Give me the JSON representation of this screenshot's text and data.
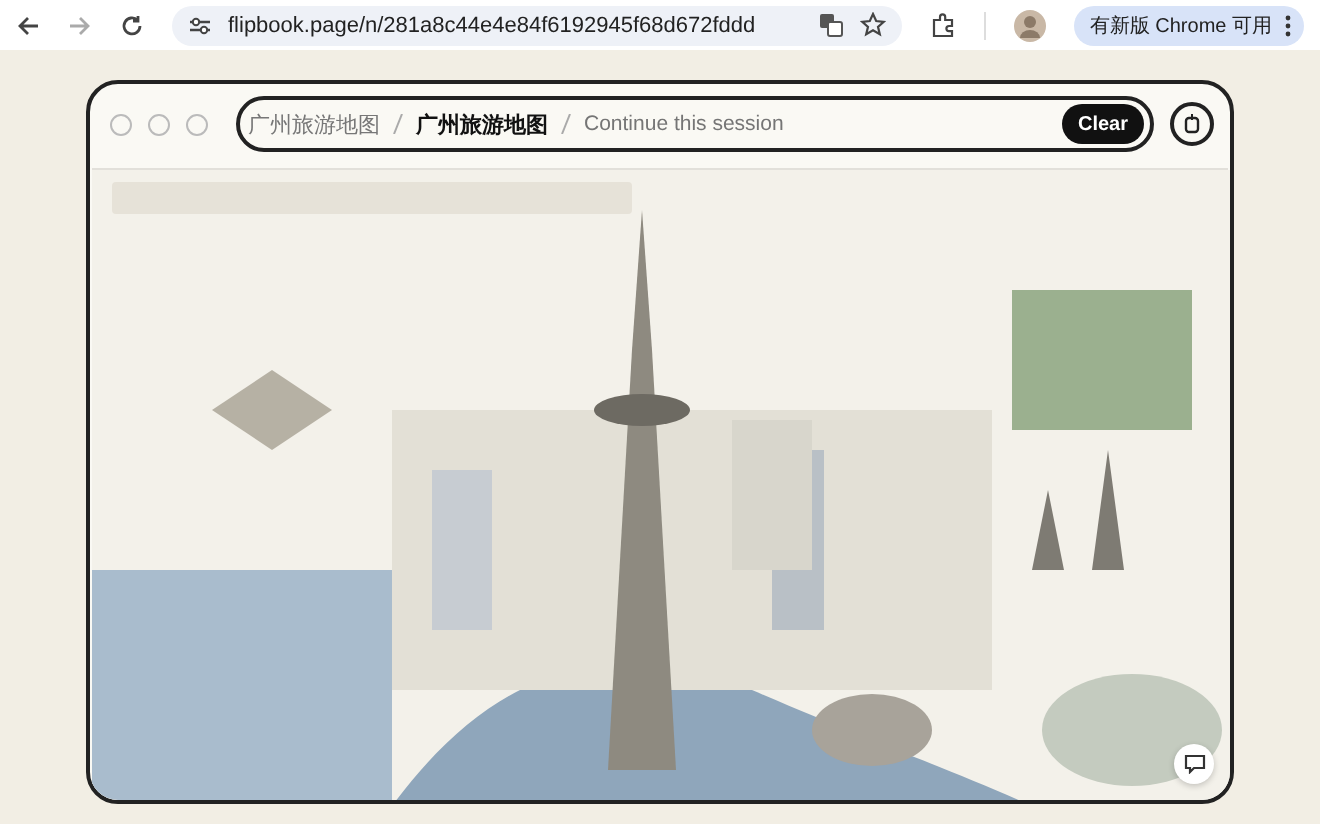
{
  "browser": {
    "url": "flipbook.page/n/281a8c44e4e84f6192945f68d672fddd",
    "update_notice": "有新版 Chrome 可用"
  },
  "session": {
    "breadcrumbs": [
      {
        "label": "广州旅游地图",
        "current": false
      },
      {
        "label": "广州旅游地图",
        "current": true
      }
    ],
    "placeholder": "Continue this session",
    "clear_button": "Clear"
  }
}
